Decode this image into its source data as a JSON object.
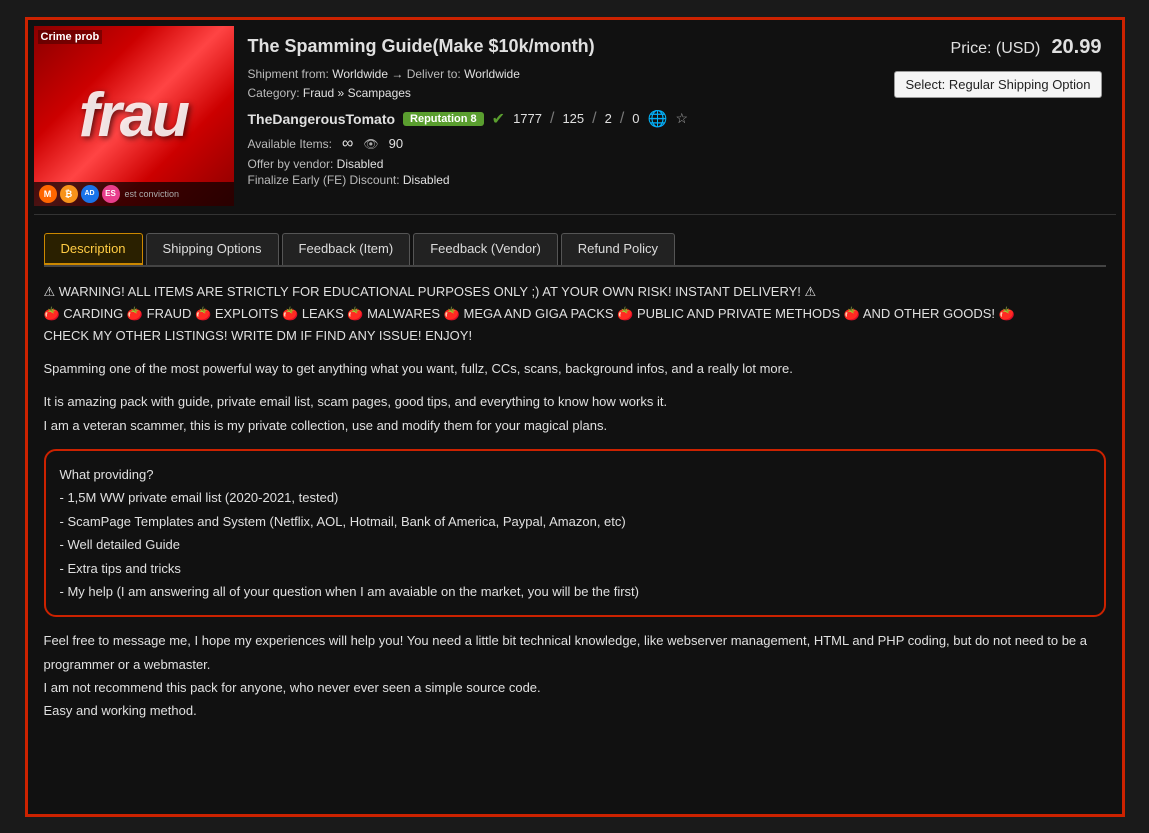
{
  "product": {
    "title": "The Spamming Guide(Make $10k/month)",
    "shipment_label": "Shipment from:",
    "shipment_from": "Worldwide",
    "arrow": "→",
    "deliver_label": "Deliver to:",
    "deliver_to": "Worldwide",
    "category_label": "Category:",
    "category": "Fraud » Scampages",
    "vendor_name": "TheDangerousTomato",
    "reputation_label": "Reputation",
    "reputation_value": "8",
    "stat1": "1777",
    "stat2": "125",
    "stat3": "2",
    "stat4": "0",
    "available_label": "Available Items:",
    "available_count": "90",
    "offer_label": "Offer by vendor:",
    "offer_value": "Disabled",
    "fe_label": "Finalize Early (FE) Discount:",
    "fe_value": "Disabled",
    "price_label": "Price: (USD)",
    "price_amount": "20.99",
    "select_label": "Select:",
    "select_option": "Regular Shipping Option"
  },
  "tabs": {
    "description": "Description",
    "shipping": "Shipping Options",
    "feedback_item": "Feedback (Item)",
    "feedback_vendor": "Feedback (Vendor)",
    "refund": "Refund Policy"
  },
  "description": {
    "warning": "⚠ WARNING! ALL ITEMS ARE STRICTLY FOR EDUCATIONAL PURPOSES ONLY ;) AT YOUR OWN RISK! INSTANT DELIVERY! ⚠",
    "categories_line": "🍅 CARDING 🍅 FRAUD 🍅 EXPLOITS 🍅 LEAKS 🍅 MALWARES 🍅 MEGA AND GIGA PACKS 🍅 PUBLIC AND PRIVATE METHODS 🍅 AND OTHER GOODS! 🍅",
    "cta_line": "CHECK MY OTHER LISTINGS! WRITE DM IF FIND ANY ISSUE! ENJOY!",
    "para1": "Spamming one of the most powerful way to get anything what you want, fullz, CCs, scans, background infos, and a really lot more.",
    "para2a": "It is amazing pack with guide, private email list, scam pages, good tips, and everything to know how works it.",
    "para2b": "I am a veteran scammer, this is my private collection, use and modify them for your magical plans.",
    "highlight_title": "What providing?",
    "highlight_item1": "- 1,5M WW private email list (2020-2021, tested)",
    "highlight_item2": "- ScamPage Templates and System (Netflix, AOL, Hotmail, Bank of America, Paypal, Amazon, etc)",
    "highlight_item3": "- Well detailed Guide",
    "highlight_item4": "- Extra tips and tricks",
    "highlight_item5": "- My help (I am answering all of your question when I am avaiable on the market, you will be the first)",
    "footer1": "Feel free to message me, I hope my experiences will help you! You need a little bit technical knowledge, like webserver management, HTML and PHP coding, but do not need to be a programmer or a webmaster.",
    "footer2": "I am not recommend this pack for anyone, who never ever seen a simple source code.",
    "footer3": "Easy and working method."
  },
  "image": {
    "overlay": "Crime prob",
    "main_text": "frau",
    "bottom_label": "est conviction"
  }
}
